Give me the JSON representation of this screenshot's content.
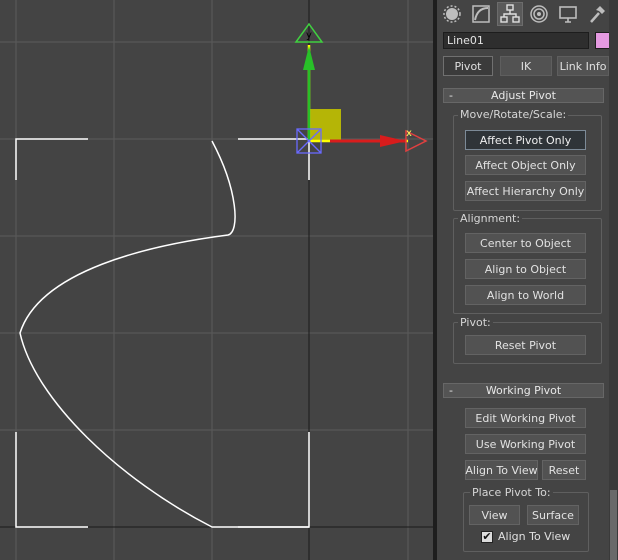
{
  "viewport": {
    "gizmo": {
      "y_label": "y",
      "x_label": "x"
    },
    "colors": {
      "background": "#444444",
      "grid": "#5b5b5b",
      "axis": "#1a1a1a",
      "spline": "#ffffff"
    }
  },
  "command_panel": {
    "tabs": [
      {
        "name": "create-tab",
        "icon": "sphere-icon"
      },
      {
        "name": "modify-tab",
        "icon": "modify-curve-icon"
      },
      {
        "name": "hierarchy-tab",
        "icon": "hierarchy-icon",
        "active": true
      },
      {
        "name": "motion-tab",
        "icon": "motion-icon"
      },
      {
        "name": "display-tab",
        "icon": "monitor-icon"
      },
      {
        "name": "utilities-tab",
        "icon": "hammer-icon"
      }
    ],
    "object_name": "Line01",
    "object_color": "#e59ae1",
    "subtabs": {
      "pivot": "Pivot",
      "ik": "IK",
      "link_info": "Link Info"
    },
    "adjust_pivot": {
      "sign": "-",
      "title": "Adjust Pivot",
      "move_group": "Move/Rotate/Scale:",
      "affect_pivot_only": "Affect Pivot Only",
      "affect_object_only": "Affect Object Only",
      "affect_hierarchy_only": "Affect Hierarchy Only",
      "alignment_group": "Alignment:",
      "center_to_object": "Center to Object",
      "align_to_object": "Align to Object",
      "align_to_world": "Align to World",
      "pivot_group": "Pivot:",
      "reset_pivot": "Reset Pivot"
    },
    "working_pivot": {
      "sign": "-",
      "title": "Working Pivot",
      "edit_working_pivot": "Edit Working Pivot",
      "use_working_pivot": "Use Working Pivot",
      "align_to_view": "Align To View",
      "reset": "Reset",
      "place_group": "Place Pivot To:",
      "view": "View",
      "surface": "Surface",
      "align_to_view_check": "Align To View",
      "check_mark": "✔"
    }
  }
}
